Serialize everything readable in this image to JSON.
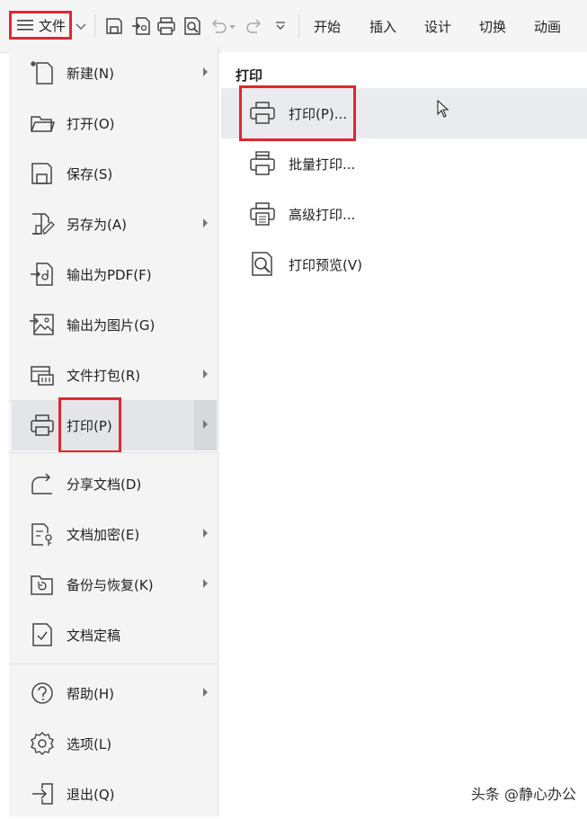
{
  "toolbar": {
    "file_label": "文件",
    "tabs": [
      "开始",
      "插入",
      "设计",
      "切换",
      "动画"
    ]
  },
  "left_menu": {
    "items": [
      {
        "label": "新建(N)",
        "icon": "new-file-icon",
        "submenu": true
      },
      {
        "label": "打开(O)",
        "icon": "folder-open-icon",
        "submenu": false
      },
      {
        "label": "保存(S)",
        "icon": "save-icon",
        "submenu": false
      },
      {
        "label": "另存为(A)",
        "icon": "save-as-icon",
        "submenu": true
      },
      {
        "label": "输出为PDF(F)",
        "icon": "export-pdf-icon",
        "submenu": false
      },
      {
        "label": "输出为图片(G)",
        "icon": "export-image-icon",
        "submenu": false
      },
      {
        "label": "文件打包(R)",
        "icon": "package-icon",
        "submenu": true
      },
      {
        "label": "打印(P)",
        "icon": "printer-icon",
        "submenu": true,
        "active": true
      },
      {
        "label": "分享文档(D)",
        "icon": "share-icon",
        "submenu": false
      },
      {
        "label": "文档加密(E)",
        "icon": "encrypt-icon",
        "submenu": true
      },
      {
        "label": "备份与恢复(K)",
        "icon": "backup-icon",
        "submenu": true
      },
      {
        "label": "文档定稿",
        "icon": "finalize-icon",
        "submenu": false
      },
      {
        "label": "帮助(H)",
        "icon": "help-icon",
        "submenu": true
      },
      {
        "label": "选项(L)",
        "icon": "gear-icon",
        "submenu": false
      },
      {
        "label": "退出(Q)",
        "icon": "exit-icon",
        "submenu": false
      }
    ]
  },
  "print_panel": {
    "title": "打印",
    "items": [
      {
        "label": "打印(P)...",
        "icon": "printer-icon",
        "hover": true
      },
      {
        "label": "批量打印...",
        "icon": "batch-print-icon"
      },
      {
        "label": "高级打印...",
        "icon": "advanced-print-icon"
      },
      {
        "label": "打印预览(V)",
        "icon": "print-preview-icon"
      }
    ]
  },
  "watermark": "头条 @静心办公",
  "colors": {
    "highlight_border": "#e0272f",
    "menu_bg": "#f4f4f5",
    "active_bg": "#e4e5e8"
  }
}
